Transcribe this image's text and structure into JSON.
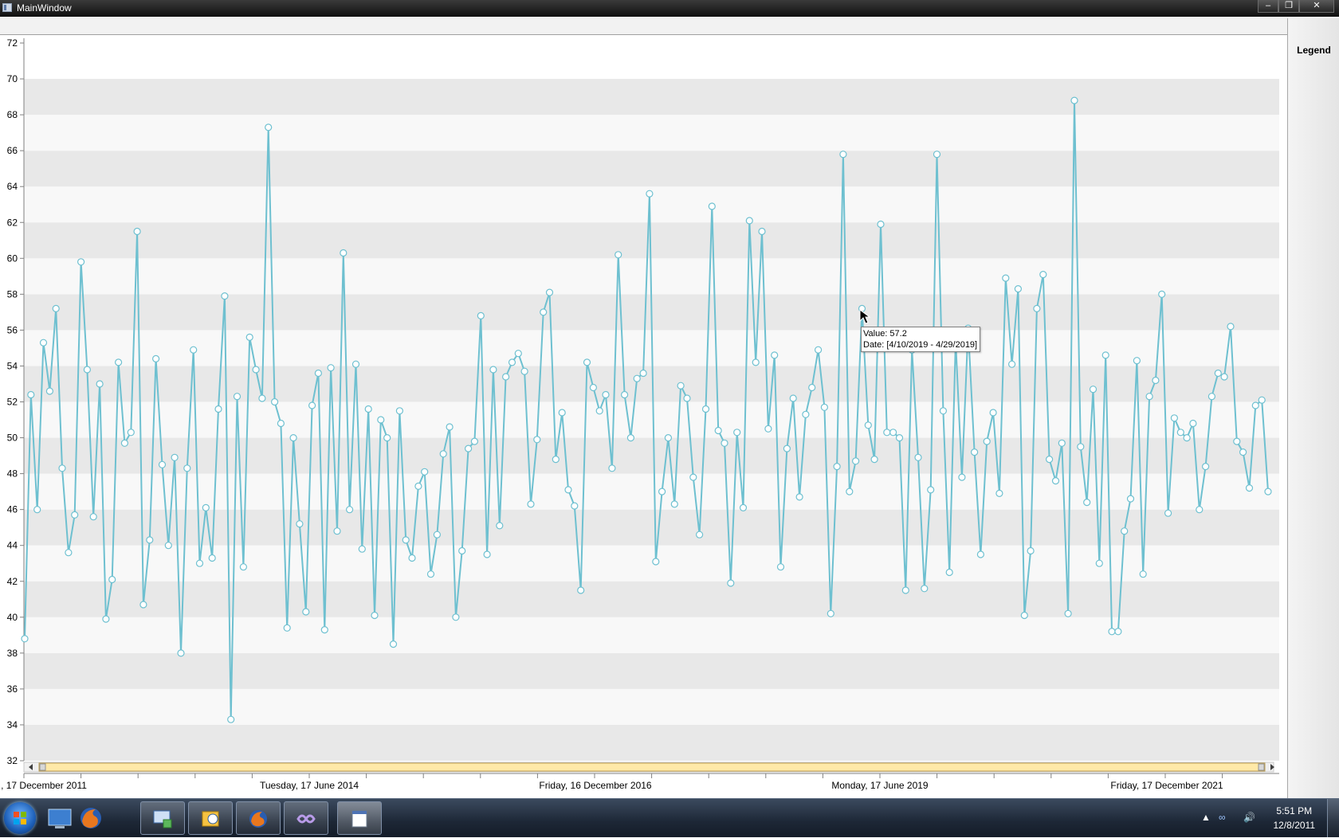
{
  "window": {
    "title": "MainWindow",
    "buttons": {
      "minimize": "‒",
      "maximize": "❐",
      "close": "✕"
    }
  },
  "legend": {
    "title": "Legend"
  },
  "tooltip": {
    "value_line": "Value: 57.2",
    "date_line": "Date: [4/10/2019 - 4/29/2019]"
  },
  "chart_data": {
    "type": "line",
    "title": "",
    "xlabel": "",
    "ylabel": "",
    "ylim": [
      32,
      72
    ],
    "y_ticks": [
      "32",
      "34",
      "36",
      "38",
      "40",
      "42",
      "44",
      "46",
      "48",
      "50",
      "52",
      "54",
      "56",
      "58",
      "60",
      "62",
      "64",
      "66",
      "68",
      "70",
      "72"
    ],
    "x_tick_labels": [
      ", 17 December 2011",
      "Tuesday, 17 June 2014",
      "Friday, 16 December 2016",
      "Monday, 17 June 2019",
      "Friday, 17 December 2021"
    ],
    "x_range": [
      "2011-12-17",
      "2022-05-20"
    ],
    "interval_days": 19,
    "grid": "alternating horizontal bands",
    "series": [
      {
        "color": "#6ec0d0",
        "values": [
          38.8,
          52.4,
          46.0,
          55.3,
          52.6,
          57.2,
          48.3,
          43.6,
          45.7,
          59.8,
          53.8,
          45.6,
          53.0,
          39.9,
          42.1,
          54.2,
          49.7,
          50.3,
          61.5,
          40.7,
          44.3,
          54.4,
          48.5,
          44.0,
          48.9,
          38.0,
          48.3,
          54.9,
          43.0,
          46.1,
          43.3,
          51.6,
          57.9,
          34.3,
          52.3,
          42.8,
          55.6,
          53.8,
          52.2,
          67.3,
          52.0,
          50.8,
          39.4,
          50.0,
          45.2,
          40.3,
          51.8,
          53.6,
          39.3,
          53.9,
          44.8,
          60.3,
          46.0,
          54.1,
          43.8,
          51.6,
          40.1,
          51.0,
          50.0,
          38.5,
          51.5,
          44.3,
          43.3,
          47.3,
          48.1,
          42.4,
          44.6,
          49.1,
          50.6,
          40.0,
          43.7,
          49.4,
          49.8,
          56.8,
          43.5,
          53.8,
          45.1,
          53.4,
          54.2,
          54.7,
          53.7,
          46.3,
          49.9,
          57.0,
          58.1,
          48.8,
          51.4,
          47.1,
          46.2,
          41.5,
          54.2,
          52.8,
          51.5,
          52.4,
          48.3,
          60.2,
          52.4,
          50.0,
          53.3,
          53.6,
          63.6,
          43.1,
          47.0,
          50.0,
          46.3,
          52.9,
          52.2,
          47.8,
          44.6,
          51.6,
          62.9,
          50.4,
          49.7,
          41.9,
          50.3,
          46.1,
          62.1,
          54.2,
          61.5,
          50.5,
          54.6,
          42.8,
          49.4,
          52.2,
          46.7,
          51.3,
          52.8,
          54.9,
          51.7,
          40.2,
          48.4,
          65.8,
          47.0,
          48.7,
          57.2,
          50.7,
          48.8,
          61.9,
          50.3,
          50.3,
          50.0,
          41.5,
          54.9,
          48.9,
          41.6,
          47.1,
          65.8,
          51.5,
          42.5,
          55.4,
          47.8,
          56.1,
          49.2,
          43.5,
          49.8,
          51.4,
          46.9,
          58.9,
          54.1,
          58.3,
          40.1,
          43.7,
          57.2,
          59.1,
          48.8,
          47.6,
          49.7,
          40.2,
          68.8,
          49.5,
          46.4,
          52.7,
          43.0,
          54.6,
          39.2,
          39.2,
          44.8,
          46.6,
          54.3,
          42.4,
          52.3,
          53.2,
          58.0,
          45.8,
          51.1,
          50.3,
          50.0,
          50.8,
          46.0,
          48.4,
          52.3,
          53.6,
          53.4,
          56.2,
          49.8,
          49.2,
          47.2,
          51.8,
          52.1,
          47.0
        ]
      }
    ]
  },
  "taskbar": {
    "clock_time": "5:51 PM",
    "clock_date": "12/8/2011",
    "items": [
      "start-orb",
      "desktop",
      "firefox",
      "remote-desktop",
      "outlook",
      "firefox",
      "visual-studio",
      "mainwindow-app"
    ]
  }
}
